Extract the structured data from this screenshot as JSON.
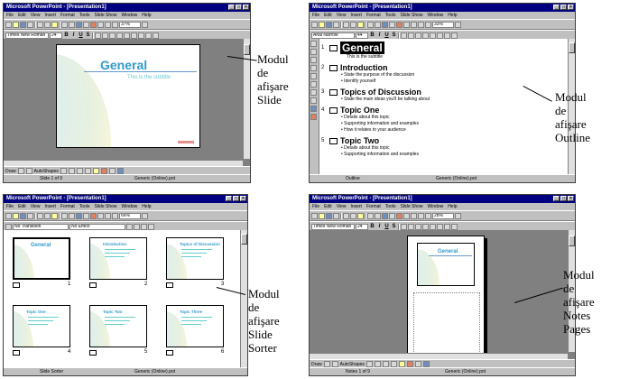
{
  "app_title": "Microsoft PowerPoint - [Presentation1]",
  "menu": [
    "File",
    "Edit",
    "View",
    "Insert",
    "Format",
    "Tools",
    "Slide Show",
    "Window",
    "Help"
  ],
  "font_name_a": "Times New Roman",
  "font_name_b": "Arial Narrow",
  "font_size_a": "24",
  "font_size_b": "44",
  "zoom_a": "37%",
  "zoom_b": "33%",
  "zoom_c": "66%",
  "zoom_d": "28%",
  "transition_a": "No Transition",
  "transition_b": "No Effect",
  "draw_label": "Draw",
  "autoshapes_label": "AutoShapes",
  "slide_view": {
    "title": "General",
    "subtitle": "This is the subtitle",
    "status_slide": "Slide 1 of 9",
    "status_template": "Generic (Online).pot",
    "caption": [
      "Modul",
      "de",
      "afişare",
      "Slide"
    ]
  },
  "outline_view": {
    "items": [
      {
        "num": "1",
        "title": "General",
        "bullets": [
          "This is the subtitle"
        ]
      },
      {
        "num": "2",
        "title": "Introduction",
        "bullets": [
          "State the purpose of the discussion",
          "Identify yourself"
        ]
      },
      {
        "num": "3",
        "title": "Topics of Discussion",
        "bullets": [
          "State the main ideas you'll be talking about"
        ]
      },
      {
        "num": "4",
        "title": "Topic One",
        "bullets": [
          "Details about this topic",
          "Supporting information and examples",
          "How it relates to your audience"
        ]
      },
      {
        "num": "5",
        "title": "Topic Two",
        "bullets": [
          "Details about this topic",
          "Supporting information and examples"
        ]
      }
    ],
    "status_left": "Outline",
    "status_template": "Generic (Online).pot",
    "caption": [
      "Modul",
      "de",
      "afişare",
      "Outline"
    ]
  },
  "sorter_view": {
    "slides": [
      {
        "num": "1",
        "title": "General"
      },
      {
        "num": "2",
        "title": "Introduction"
      },
      {
        "num": "3",
        "title": "Topics of Discussion"
      },
      {
        "num": "4",
        "title": "Topic One"
      },
      {
        "num": "5",
        "title": "Topic Two"
      },
      {
        "num": "6",
        "title": "Topic Three"
      }
    ],
    "status_left": "Slide Sorter",
    "status_template": "Generic (Online).pot",
    "caption": [
      "Modul",
      "de",
      "afişare",
      "Slide",
      "Sorter"
    ]
  },
  "notes_view": {
    "title": "General",
    "status_slide": "Notes 1 of 9",
    "status_template": "Generic (Online).pot",
    "caption": [
      "Modul",
      "de",
      "afişare",
      "Notes",
      "Pages"
    ]
  }
}
